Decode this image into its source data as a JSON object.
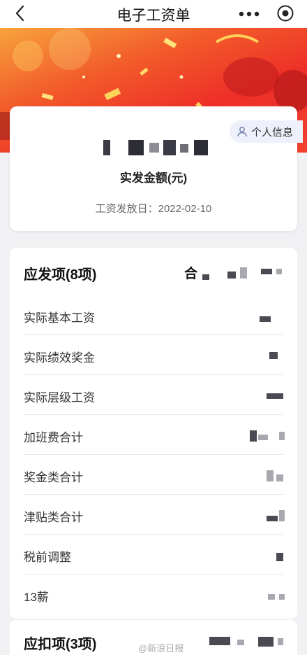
{
  "header": {
    "title": "电子工资单",
    "back_icon": "chevron-left-icon",
    "more_icon": "more-dots-icon",
    "close_icon": "target-close-icon"
  },
  "banner": {
    "theme_colors": [
      "#f7a33c",
      "#ee2f28"
    ]
  },
  "summary": {
    "personal_info_label": "个人信息",
    "amount_label": "实发金额(元)",
    "pay_date": "工资发放日：2022-02-10"
  },
  "earnings": {
    "title": "应发项(8项)",
    "total_label": "合",
    "items": [
      {
        "label": "实际基本工资"
      },
      {
        "label": "实际绩效奖金"
      },
      {
        "label": "实际层级工资"
      },
      {
        "label": "加班费合计"
      },
      {
        "label": "奖金类合计"
      },
      {
        "label": "津贴类合计"
      },
      {
        "label": "税前调整"
      },
      {
        "label": "13薪"
      }
    ]
  },
  "deductions": {
    "title": "应扣项(3项)"
  },
  "watermark": "@新浪日报"
}
